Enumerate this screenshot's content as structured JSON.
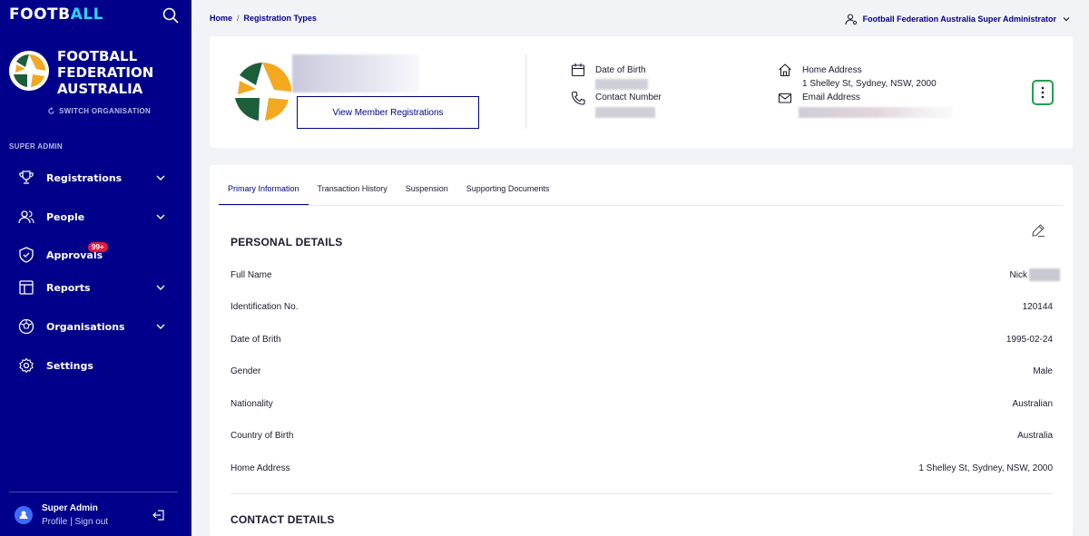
{
  "sidebar": {
    "brand_a": "FOOTB",
    "brand_b": "ALL",
    "org_name": "FOOTBALL FEDERATION AUSTRALIA",
    "switch_label": "SWITCH ORGANISATION",
    "section_label": "SUPER ADMIN",
    "items": [
      {
        "label": "Registrations",
        "icon": "trophy-icon"
      },
      {
        "label": "People",
        "icon": "people-icon"
      },
      {
        "label": "Approvals",
        "icon": "shield-check-icon",
        "badge": "99+"
      },
      {
        "label": "Reports",
        "icon": "reports-icon"
      },
      {
        "label": "Organisations",
        "icon": "soccer-ball-icon"
      },
      {
        "label": "Settings",
        "icon": "gear-icon"
      }
    ],
    "user": {
      "name": "Super Admin",
      "profile_link": "Profile",
      "separator": " | ",
      "signout_link": "Sign out"
    }
  },
  "header": {
    "breadcrumb": [
      "Home",
      "Registration Types"
    ],
    "admin_label": "Football Federation Australia Super Administrator"
  },
  "profile": {
    "view_button": "View Member Registrations",
    "dob_label": "Date of Birth",
    "contact_label": "Contact Number",
    "address_label": "Home Address",
    "address_value": "1 Shelley St, Sydney, NSW, 2000",
    "email_label": "Email Address"
  },
  "tabs": [
    "Primary Information",
    "Transaction History",
    "Suspension",
    "Supporting Documents"
  ],
  "personal": {
    "title": "PERSONAL DETAILS",
    "rows": [
      {
        "label": "Full Name",
        "value": "Nick"
      },
      {
        "label": "Identification No.",
        "value": "120144"
      },
      {
        "label": "Date of Brith",
        "value": "1995-02-24"
      },
      {
        "label": "Gender",
        "value": "Male"
      },
      {
        "label": "Nationality",
        "value": "Australian"
      },
      {
        "label": "Country of Birth",
        "value": "Australia"
      },
      {
        "label": "Home Address",
        "value": "1 Shelley St, Sydney, NSW, 2000"
      }
    ]
  },
  "contact": {
    "title": "CONTACT DETAILS"
  },
  "colors": {
    "sidebar_bg": "#00008b",
    "accent": "#00008b",
    "kebab_border": "#1fa04a",
    "badge": "#e8173a"
  }
}
